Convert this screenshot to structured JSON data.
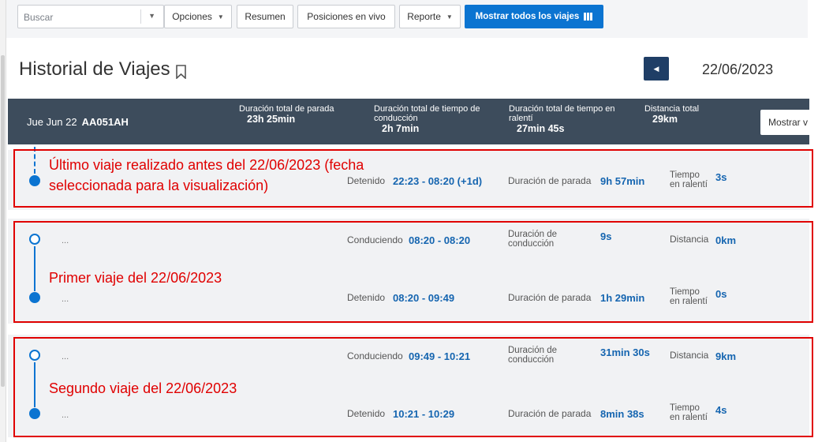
{
  "toolbar": {
    "search_placeholder": "Buscar",
    "options_label": "Opciones",
    "summary_label": "Resumen",
    "live_positions_label": "Posiciones en vivo",
    "report_label": "Reporte",
    "show_all_label": "Mostrar todos los viajes"
  },
  "header": {
    "title": "Historial de Viajes",
    "date": "22/06/2023"
  },
  "summary": {
    "date_label": "Jue Jun 22",
    "vehicle": "AA051AH",
    "stop_label": "Duración total de parada",
    "stop_value": "23h 25min",
    "drive_label_1": "Duración total de tiempo de",
    "drive_label_2": "conducción",
    "drive_value": "2h 7min",
    "idle_label_1": "Duración total de tiempo en",
    "idle_label_2": "ralentí",
    "idle_value": "27min 45s",
    "distance_label": "Distancia total",
    "distance_value": "29km",
    "show_button": "Mostrar v"
  },
  "trips": [
    {
      "stop_state": "Detenido",
      "stop_time": "22:23 - 08:20 (+1d)",
      "stop_duration_label": "Duración de parada",
      "stop_duration": "9h 57min",
      "idle_label_1": "Tiempo",
      "idle_label_2": "en ralentí",
      "idle_value": "3s"
    },
    {
      "ellipsis_top": "...",
      "ellipsis_bottom": "...",
      "drive_state": "Conduciendo",
      "drive_time": "08:20 - 08:20",
      "drive_duration_label_1": "Duración de",
      "drive_duration_label_2": "conducción",
      "drive_duration": "9s",
      "distance_label": "Distancia",
      "distance_value": "0km",
      "stop_state": "Detenido",
      "stop_time": "08:20 - 09:49",
      "stop_duration_label": "Duración de parada",
      "stop_duration": "1h 29min",
      "idle_label_1": "Tiempo",
      "idle_label_2": "en ralentí",
      "idle_value": "0s"
    },
    {
      "ellipsis_top": "...",
      "ellipsis_bottom": "...",
      "drive_state": "Conduciendo",
      "drive_time": "09:49 - 10:21",
      "drive_duration_label_1": "Duración de",
      "drive_duration_label_2": "conducción",
      "drive_duration": "31min 30s",
      "distance_label": "Distancia",
      "distance_value": "9km",
      "stop_state": "Detenido",
      "stop_time": "10:21 - 10:29",
      "stop_duration_label": "Duración de parada",
      "stop_duration": "8min 38s",
      "idle_label_1": "Tiempo",
      "idle_label_2": "en ralentí",
      "idle_value": "4s"
    }
  ],
  "annotations": {
    "first_line_1": "Último viaje realizado antes del 22/06/2023 (fecha",
    "first_line_2": "seleccionada para la visualización)",
    "second": "Primer viaje del 22/06/2023",
    "third": "Segundo viaje del 22/06/2023",
    "color": "#e00000"
  },
  "colors": {
    "accent": "#0b74d1",
    "header_band": "#3d4c5c",
    "nav_button": "#1f3e66",
    "value_text": "#1565b0"
  },
  "icons": {
    "bookmark": "bookmark-icon",
    "map": "map-icon",
    "prev": "chevron-left-icon",
    "dropdown": "caret-down-icon"
  }
}
